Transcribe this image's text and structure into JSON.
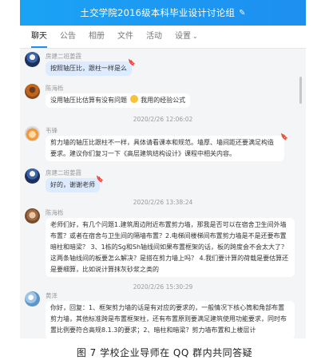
{
  "window": {
    "title": "土交学院2016级本科毕业设计讨论组",
    "edit_icon": "✎"
  },
  "tabs": [
    {
      "label": "聊天"
    },
    {
      "label": "公告"
    },
    {
      "label": "相册"
    },
    {
      "label": "文件"
    },
    {
      "label": "活动"
    },
    {
      "label": "设置",
      "chevron": "⌄"
    }
  ],
  "messages": [
    {
      "sender": "房建二班姜霞",
      "text": "按照轴压比，跟柱一样是么"
    },
    {
      "sender": "陈海栎",
      "text": "没用轴压比估算有没有问题",
      "text_after_emoji": "我用的经验公式"
    },
    {
      "timestamp": "2020/2/26 12:06:02"
    },
    {
      "sender": "韦锋",
      "text": "剪力墙的轴压比跟柱不一样，具体请看课本和规范。墙厚、墙间距还要满足构造要求。建议你们复习一下《高层建筑结构设计》课程中相关内容。"
    },
    {
      "sender": "房建二班姜霞",
      "text": "好的，谢谢老师"
    },
    {
      "timestamp": "2020/2/26 13:38:24"
    },
    {
      "sender": "陈海栎",
      "text": "老师们好，有几个问题1.建筑周边附近布置剪力墙，那我是否可以在宿舍卫生间外墙布置？或者在宿舍与卫生间的隔墙布置？2.电梯间楼梯间布置剪力墙是不是还要布置暗柱和暗梁？ 3、1栋的Sg和Sh轴线间如果布置框架的话，板的跨度会不会太大了？这两条轴线间的板要怎么解决？是搭在剪力墙上吗？ 4.我们要计算的荷载是要估算还是要细算，比如说计算抹灰砂浆之类的"
    },
    {
      "timestamp": "2020/2/26 15:30:29"
    },
    {
      "sender": "黄泽",
      "text": "你好，回复：1、框架剪力墙的话是有对应的要求的，一般情况下核心筒和角部布置剪力墙，其他标准跨是布置框架柱，还有布置原则要满足建筑使用功能要求，同时布置比例要符合高规8.1.3的要求；2、暗柱和暗梁？剪力墙布置和上楼层计"
    }
  ],
  "caption": "图 7 学校企业导师在 QQ 群内共同答疑"
}
